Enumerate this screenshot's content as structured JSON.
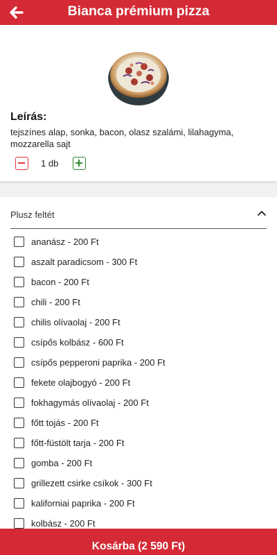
{
  "header": {
    "title": "Bianca prémium pizza"
  },
  "product": {
    "description_heading": "Leírás:",
    "description": "tejszínes alap, sonka, bacon, olasz szalámi, lilahagyma, mozzarella  sajt",
    "quantity": "1 db"
  },
  "extras": {
    "title": "Plusz feltét",
    "options": [
      "ananász - 200 Ft",
      "aszalt paradicsom - 300 Ft",
      "bacon - 200 Ft",
      "chili - 200 Ft",
      "chilis olívaolaj - 200 Ft",
      "csípős kolbász - 600 Ft",
      "csípős pepperoni paprika - 200 Ft",
      "fekete olajbogyó - 200 Ft",
      "fokhagymás olívaolaj - 200 Ft",
      "főtt tojás - 200 Ft",
      "főtt-füstölt tarja - 200 Ft",
      "gomba - 200 Ft",
      "grillezett csirke csíkok - 300 Ft",
      "kaliforniai paprika - 200 Ft",
      "kolbász - 200 Ft"
    ]
  },
  "cart": {
    "button_label": "Kosárba (2 590 Ft)"
  },
  "colors": {
    "brand_red": "#d42a35",
    "minus_red": "#e0323b",
    "plus_green": "#2c8a2c"
  },
  "icons": {
    "back": "arrow-left-icon",
    "collapse": "chevron-up-icon",
    "minus": "minus-square-icon",
    "plus": "plus-square-icon"
  }
}
